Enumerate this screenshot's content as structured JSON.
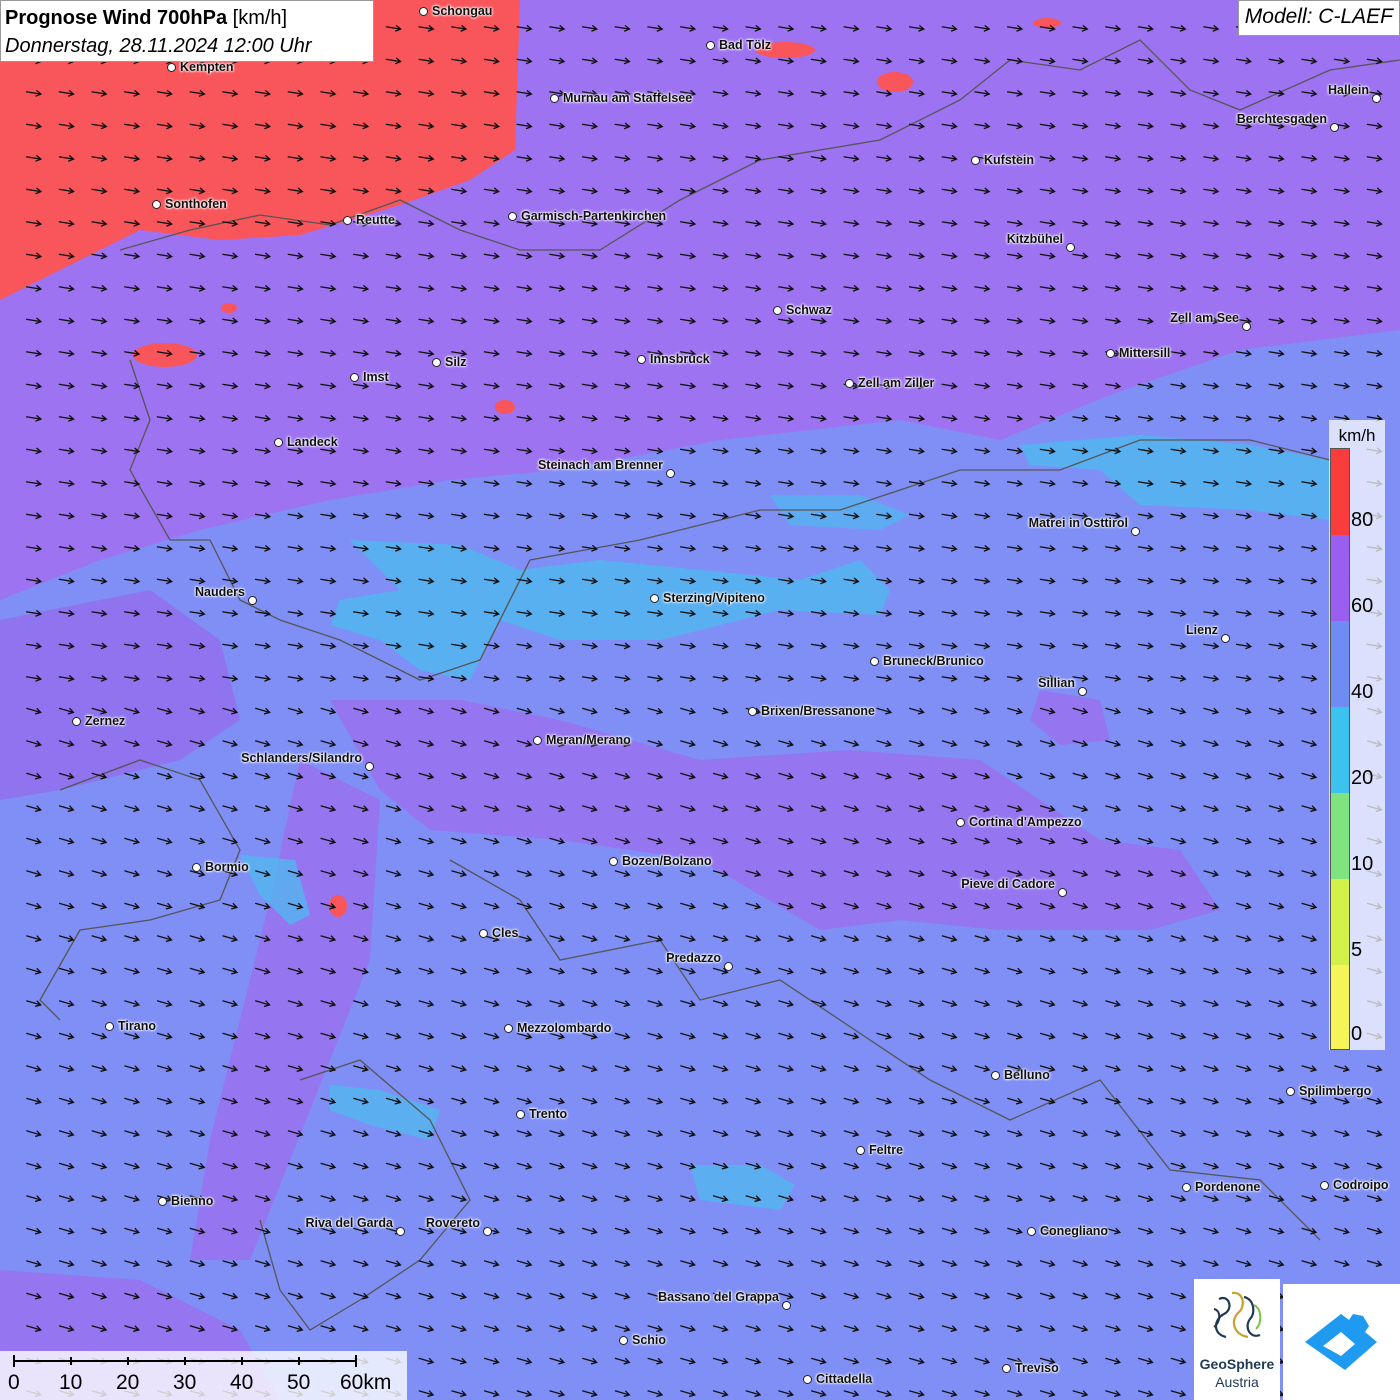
{
  "title": {
    "bold": "Prognose Wind 700hPa",
    "unit": "[km/h]",
    "datetime": "Donnerstag, 28.11.2024 12:00 Uhr"
  },
  "model": "Modell: C-LAEF",
  "legend": {
    "unit": "km/h",
    "labels": [
      "80",
      "60",
      "40",
      "20",
      "10",
      "5",
      "0"
    ],
    "colors": [
      "#fa3c3c",
      "#9a5ef0",
      "#6f8cf2",
      "#3cc2ef",
      "#7fe37f",
      "#d2f24a",
      "#f5f55a"
    ]
  },
  "scalebar": {
    "labels": [
      "0",
      "10",
      "20",
      "30",
      "40",
      "50",
      "60km"
    ]
  },
  "cities": [
    {
      "name": "Schongau"
    },
    {
      "name": "Kempten"
    },
    {
      "name": "Bad Tölz"
    },
    {
      "name": "Murnau am Staffelsee"
    },
    {
      "name": "Hallein"
    },
    {
      "name": "Berchtesgaden"
    },
    {
      "name": "Kufstein"
    },
    {
      "name": "Sonthofen"
    },
    {
      "name": "Reutte"
    },
    {
      "name": "Garmisch-Partenkirchen"
    },
    {
      "name": "Kitzbühel"
    },
    {
      "name": "Schwaz"
    },
    {
      "name": "Zell am See"
    },
    {
      "name": "Mittersill"
    },
    {
      "name": "Innsbruck"
    },
    {
      "name": "Silz"
    },
    {
      "name": "Imst"
    },
    {
      "name": "Zell am Ziller"
    },
    {
      "name": "Landeck"
    },
    {
      "name": "Steinach am Brenner"
    },
    {
      "name": "Matrei in Osttirol"
    },
    {
      "name": "Nauders"
    },
    {
      "name": "Sterzing/Vipiteno"
    },
    {
      "name": "Lienz"
    },
    {
      "name": "Bruneck/Brunico"
    },
    {
      "name": "Sillian"
    },
    {
      "name": "Brixen/Bressanone"
    },
    {
      "name": "Zernez"
    },
    {
      "name": "Meran/Merano"
    },
    {
      "name": "Schlanders/Silandro"
    },
    {
      "name": "Cortina d'Ampezzo"
    },
    {
      "name": "Bozen/Bolzano"
    },
    {
      "name": "Bormio"
    },
    {
      "name": "Pieve di Cadore"
    },
    {
      "name": "Cles"
    },
    {
      "name": "Predazzo"
    },
    {
      "name": "Tirano"
    },
    {
      "name": "Mezzolombardo"
    },
    {
      "name": "Belluno"
    },
    {
      "name": "Spilimbergo"
    },
    {
      "name": "Trento"
    },
    {
      "name": "Feltre"
    },
    {
      "name": "Bienno"
    },
    {
      "name": "Pordenone"
    },
    {
      "name": "Codroipo"
    },
    {
      "name": "Riva del Garda"
    },
    {
      "name": "Rovereto"
    },
    {
      "name": "Conegliano"
    },
    {
      "name": "Bassano del Grappa"
    },
    {
      "name": "Schio"
    },
    {
      "name": "Treviso"
    },
    {
      "name": "Cittadella"
    }
  ],
  "logos": {
    "geosphere_line1": "GeoSphere",
    "geosphere_line2": "Austria"
  }
}
